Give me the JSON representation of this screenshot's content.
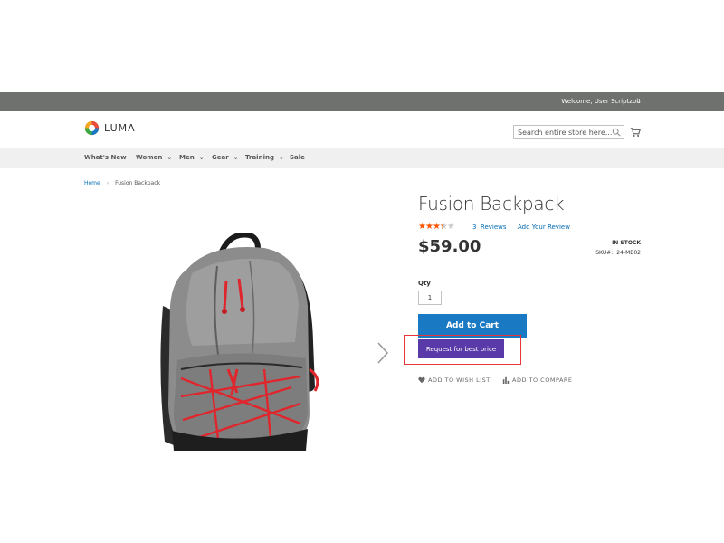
{
  "header": {
    "welcome": "Welcome, User Scriptzol!",
    "logo_text": "LUMA",
    "search_placeholder": "Search entire store here..."
  },
  "nav": {
    "items": [
      {
        "label": "What's New"
      },
      {
        "label": "Women"
      },
      {
        "label": "Men"
      },
      {
        "label": "Gear"
      },
      {
        "label": "Training"
      },
      {
        "label": "Sale"
      }
    ]
  },
  "breadcrumb": {
    "home": "Home",
    "current": "Fusion Backpack"
  },
  "product": {
    "name": "Fusion Backpack",
    "rating_stars": 3.5,
    "reviews_count": "3",
    "reviews_label": "Reviews",
    "add_review": "Add Your Review",
    "price": "$59.00",
    "stock": "IN STOCK",
    "sku_label": "SKU#:",
    "sku": "24-MB02",
    "qty_label": "Qty",
    "qty_value": "1",
    "add_to_cart": "Add to Cart",
    "best_price": "Request for best price",
    "wishlist": "ADD TO WISH LIST",
    "compare": "ADD TO COMPARE"
  },
  "colors": {
    "topbar": "#6e716e",
    "primary_button": "#1979c3",
    "best_price_button": "#5a3aa8",
    "highlight": "#e8353a",
    "link": "#006bb4",
    "stars": "#ff5501"
  }
}
